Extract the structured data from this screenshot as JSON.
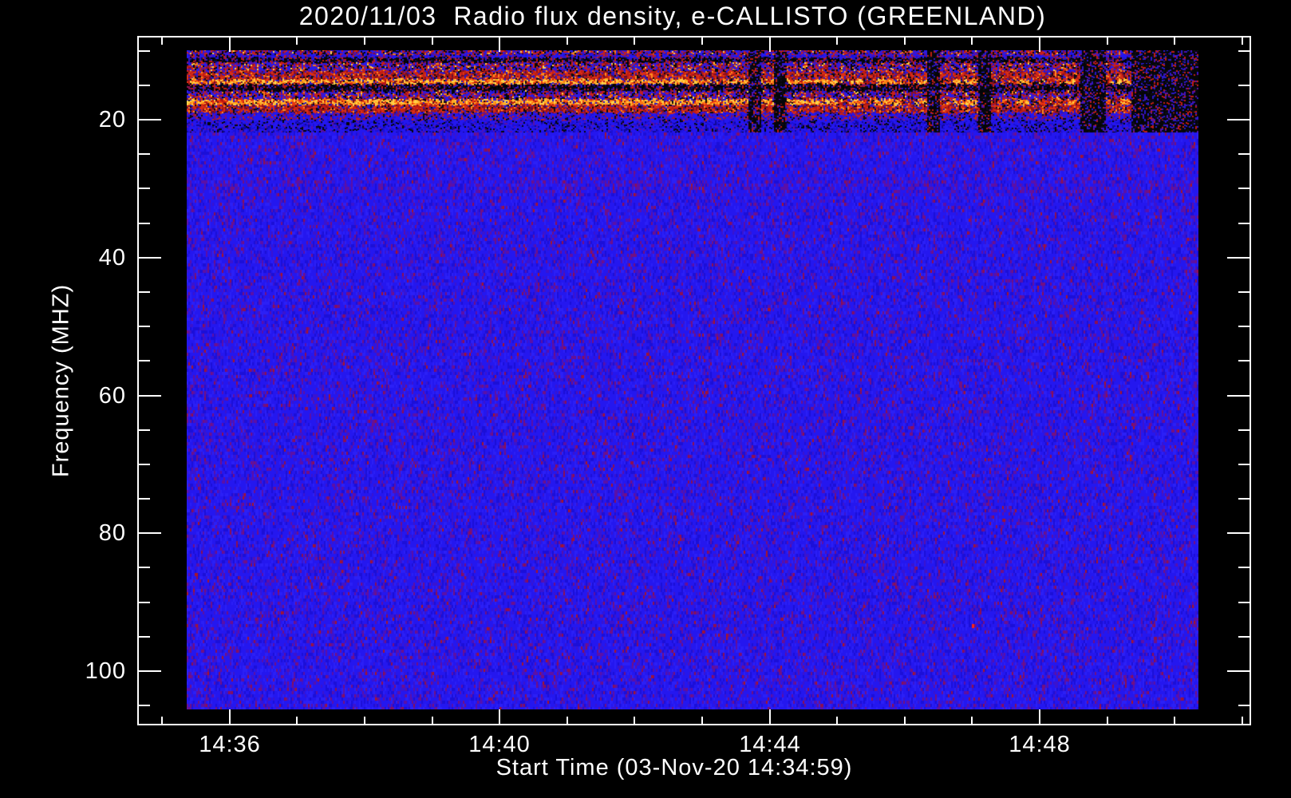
{
  "window": {
    "background": "#000000"
  },
  "chart_data": {
    "type": "heatmap",
    "title": "2020/11/03  Radio flux density, e-CALLISTO (GREENLAND)",
    "xlabel": "Start Time (03-Nov-20 14:34:59)",
    "ylabel": "Frequency (MHZ)",
    "station": "GREENLAND",
    "instrument": "e-CALLISTO",
    "date": "2020/11/03",
    "start_time": "14:34:59",
    "legend": "none",
    "grid": "off",
    "colors": {
      "frame": "#ffffff",
      "text": "#ffffff",
      "background": "#000000",
      "base_blue": "#2417ef"
    },
    "x_axis": {
      "label": "Start Time (03-Nov-20 14:34:59)",
      "major_ticks": [
        {
          "minute": 36,
          "label": "14:36"
        },
        {
          "minute": 40,
          "label": "14:40"
        },
        {
          "minute": 44,
          "label": "14:44"
        },
        {
          "minute": 48,
          "label": "14:48"
        }
      ],
      "minor_tick_minutes": [
        35,
        37,
        38,
        39,
        41,
        42,
        43,
        45,
        46,
        47,
        49,
        50,
        51
      ],
      "range_minutes": [
        34.63,
        51.12
      ]
    },
    "y_axis": {
      "label": "Frequency (MHZ)",
      "major_ticks": [
        20,
        40,
        60,
        80,
        100
      ],
      "minor_ticks": [
        10,
        15,
        25,
        30,
        35,
        45,
        50,
        55,
        65,
        70,
        75,
        85,
        90,
        95,
        105
      ],
      "range_mhz": [
        7.9,
        108.3
      ],
      "orientation": "increasing-downward"
    },
    "data_extent": {
      "minutes": [
        35.35,
        50.35
      ],
      "mhz": [
        9.9,
        105.5
      ]
    },
    "bands": [
      {
        "f0": 9.9,
        "f1": 10.6,
        "palette": "mix",
        "desc": "dense multicolor RFI speckle row"
      },
      {
        "f0": 10.6,
        "f1": 11.1,
        "palette": "bluespeck",
        "desc": "blue with red speckle"
      },
      {
        "f0": 11.1,
        "f1": 11.8,
        "palette": "dark",
        "desc": "dark dropout band"
      },
      {
        "f0": 11.8,
        "f1": 13.1,
        "palette": "mix",
        "desc": "blue/red mixed band"
      },
      {
        "f0": 13.1,
        "f1": 14.2,
        "palette": "red",
        "desc": "red emission band"
      },
      {
        "f0": 14.2,
        "f1": 14.95,
        "palette": "hotline",
        "desc": "bright yellow-orange RFI line ~14.5 MHz"
      },
      {
        "f0": 14.95,
        "f1": 15.9,
        "palette": "dark",
        "desc": "black band"
      },
      {
        "f0": 15.9,
        "f1": 17.05,
        "palette": "mix",
        "desc": "blue/red mixed band"
      },
      {
        "f0": 17.05,
        "f1": 17.95,
        "palette": "hotline",
        "desc": "bright yellow-orange RFI line ~17.5 MHz"
      },
      {
        "f0": 17.95,
        "f1": 19.05,
        "palette": "red",
        "desc": "red emission band"
      },
      {
        "f0": 19.05,
        "f1": 20.1,
        "palette": "bluespeck",
        "desc": "blue-purple speckle"
      },
      {
        "f0": 20.1,
        "f1": 21.9,
        "palette": "bluestripe",
        "desc": "blue with dark vertical stripes"
      }
    ],
    "body": {
      "f0": 21.9,
      "f1": 105.5,
      "palette": "body",
      "dense_speckle_mhz": [
        28.5,
        30.5
      ],
      "desc": "quiet blue background with purple/red noise speckle"
    },
    "right_side_dropouts": {
      "start_fraction": 0.44,
      "desc": "intermittent black dropout columns in the 10-22 MHz RFI zone, increasing toward the right edge"
    },
    "hot_pixels": [
      {
        "minute": 47.0,
        "mhz": 93.2
      }
    ],
    "palettes": {
      "body": [
        [
          "#2417ef",
          0.46
        ],
        [
          "#2b20f6",
          0.16
        ],
        [
          "#1b0fd8",
          0.14
        ],
        [
          "#3a14cf",
          0.1
        ],
        [
          "#5c10a6",
          0.08
        ],
        [
          "#731082",
          0.04
        ],
        [
          "#8e1050",
          0.015
        ],
        [
          "#a81628",
          0.005
        ]
      ],
      "bluespeck": [
        [
          "#2417ef",
          0.44
        ],
        [
          "#1b0fd8",
          0.14
        ],
        [
          "#5c10a6",
          0.12
        ],
        [
          "#8e1050",
          0.09
        ],
        [
          "#c02418",
          0.1
        ],
        [
          "#0a0a14",
          0.11
        ]
      ],
      "bluestripe": [
        [
          "#2417ef",
          0.48
        ],
        [
          "#1b0fd8",
          0.2
        ],
        [
          "#12089a",
          0.12
        ],
        [
          "#5c10a6",
          0.08
        ],
        [
          "#060608",
          0.12
        ]
      ],
      "mix": [
        [
          "#2a1ae6",
          0.3
        ],
        [
          "#c8201a",
          0.22
        ],
        [
          "#901020",
          0.1
        ],
        [
          "#060608",
          0.16
        ],
        [
          "#5c10a6",
          0.1
        ],
        [
          "#f07b16",
          0.06
        ],
        [
          "#ffd24a",
          0.03
        ],
        [
          "#1b0fd8",
          0.03
        ]
      ],
      "red": [
        [
          "#da2f16",
          0.26
        ],
        [
          "#c01d12",
          0.22
        ],
        [
          "#8e101c",
          0.14
        ],
        [
          "#ff8c1e",
          0.07
        ],
        [
          "#5a0e34",
          0.08
        ],
        [
          "#2a18c8",
          0.14
        ],
        [
          "#0a0a10",
          0.09
        ]
      ],
      "hotline": [
        [
          "#ffd24a",
          0.26
        ],
        [
          "#ffab22",
          0.22
        ],
        [
          "#ff7412",
          0.18
        ],
        [
          "#e83410",
          0.12
        ],
        [
          "#b81410",
          0.08
        ],
        [
          "#60102a",
          0.05
        ],
        [
          "#0a0a10",
          0.04
        ],
        [
          "#2a18c8",
          0.05
        ]
      ],
      "hotline_right": [
        [
          "#e83410",
          0.22
        ],
        [
          "#b81410",
          0.18
        ],
        [
          "#ff7412",
          0.1
        ],
        [
          "#ffd24a",
          0.05
        ],
        [
          "#60102a",
          0.12
        ],
        [
          "#0a0a10",
          0.18
        ],
        [
          "#2a18c8",
          0.15
        ]
      ],
      "dark": [
        [
          "#08080e",
          0.34
        ],
        [
          "#000000",
          0.22
        ],
        [
          "#150b52",
          0.1
        ],
        [
          "#2a18c8",
          0.14
        ],
        [
          "#8e1050",
          0.08
        ],
        [
          "#c01d12",
          0.12
        ]
      ],
      "blackcol": [
        [
          "#050508",
          0.55
        ],
        [
          "#0d0d1a",
          0.15
        ],
        [
          "#2a18c8",
          0.15
        ],
        [
          "#c01d12",
          0.1
        ],
        [
          "#5c10a6",
          0.05
        ]
      ]
    }
  }
}
